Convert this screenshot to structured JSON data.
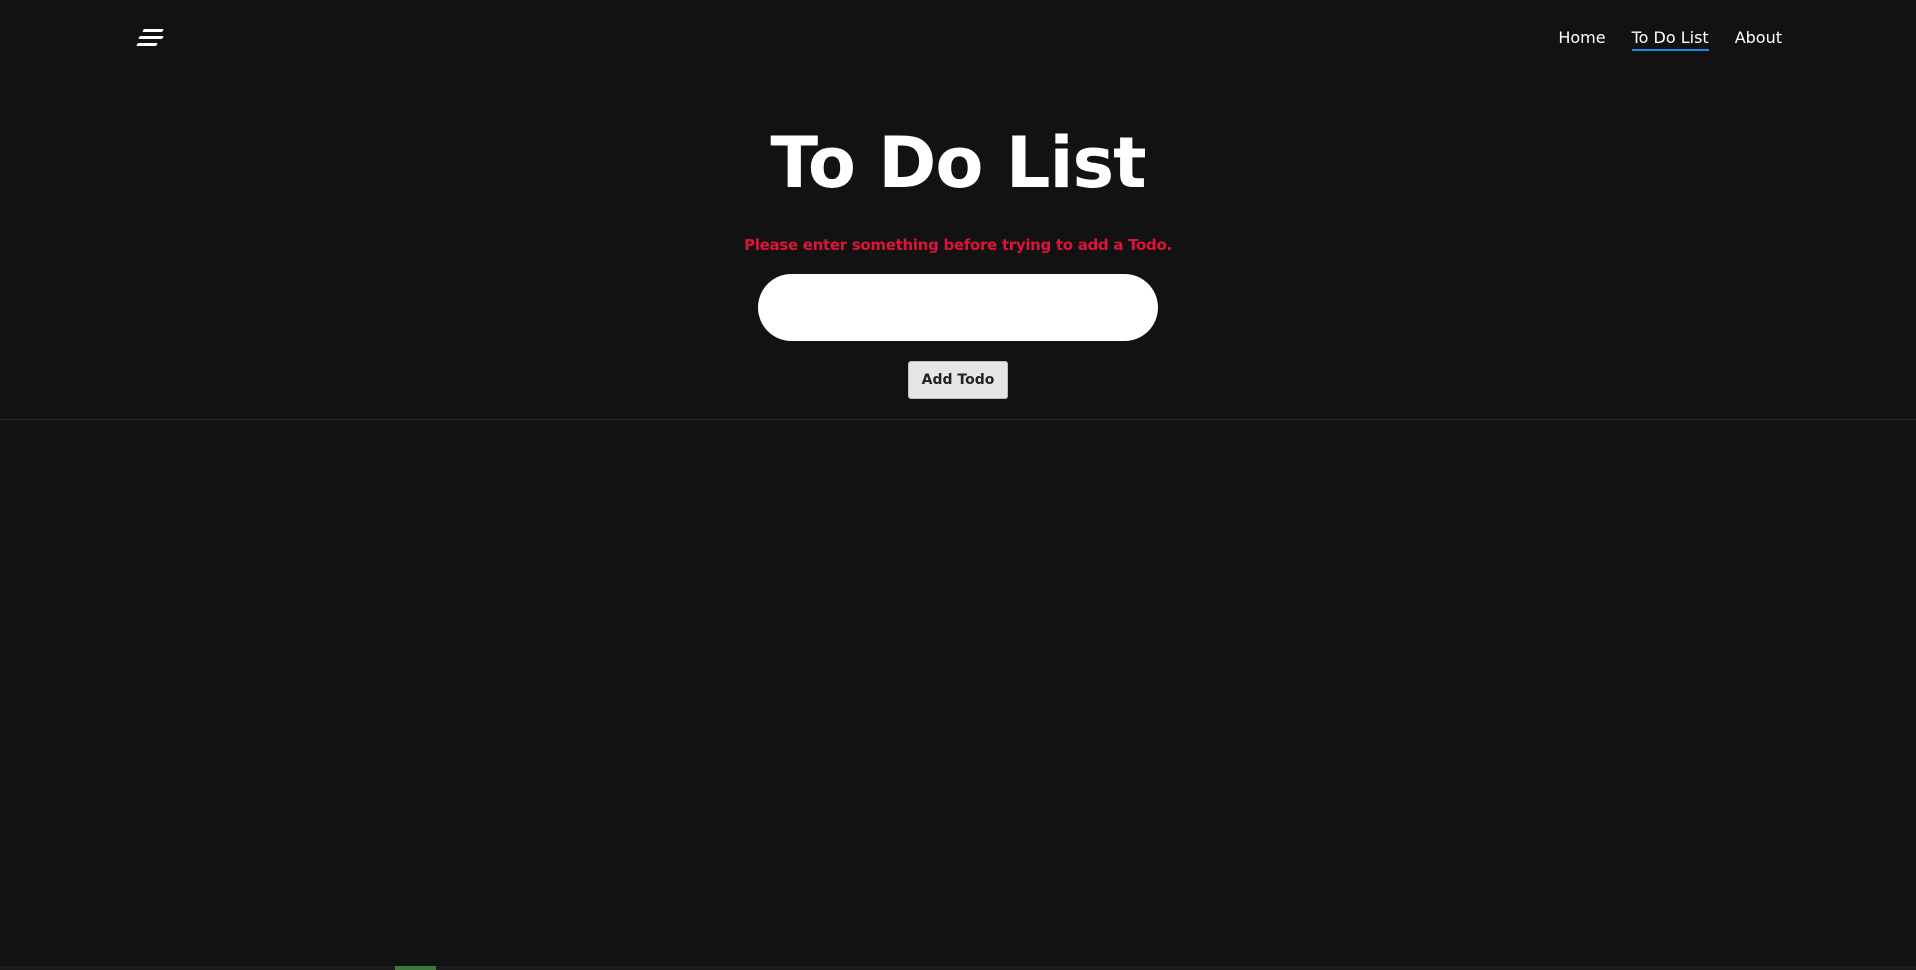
{
  "header": {
    "logo_icon": "menu-lines-icon",
    "nav": [
      {
        "label": "Home",
        "active": false
      },
      {
        "label": "To Do List",
        "active": true
      },
      {
        "label": "About",
        "active": false
      }
    ]
  },
  "main": {
    "title": "To Do List",
    "error_message": "Please enter something before trying to add a Todo.",
    "input": {
      "value": "",
      "placeholder": ""
    },
    "add_button_label": "Add Todo"
  },
  "colors": {
    "background": "#121212",
    "error": "#dc143c",
    "active_underline": "#1e88e5"
  }
}
